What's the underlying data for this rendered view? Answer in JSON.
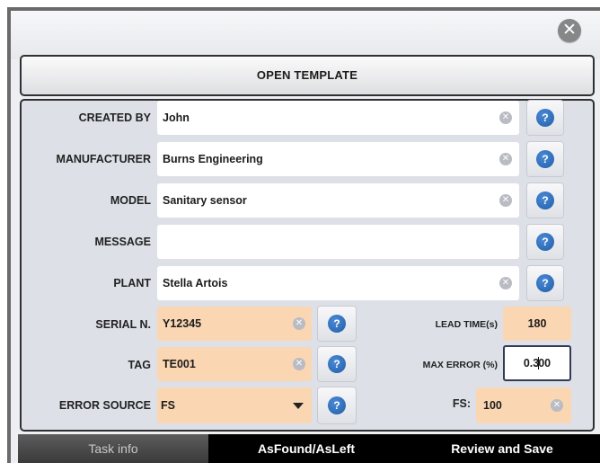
{
  "header": {
    "close_label": "✕",
    "open_template_label": "OPEN TEMPLATE"
  },
  "form": {
    "created_by": {
      "label": "CREATED BY",
      "value": "John"
    },
    "manufacturer": {
      "label": "MANUFACTURER",
      "value": "Burns Engineering"
    },
    "model": {
      "label": "MODEL",
      "value": "Sanitary sensor"
    },
    "message": {
      "label": "MESSAGE",
      "value": ""
    },
    "plant": {
      "label": "PLANT",
      "value": "Stella Artois"
    },
    "serial": {
      "label": "SERIAL N.",
      "value": "Y12345"
    },
    "tag": {
      "label": "TAG",
      "value": "TE001"
    },
    "error_source": {
      "label": "ERROR SOURCE",
      "value": "FS"
    },
    "lead_time": {
      "label": "LEAD TIME(s)",
      "value": "180"
    },
    "max_error": {
      "label": "MAX ERROR (%)",
      "value_before_caret": "0.3",
      "value_after_caret": "00"
    },
    "fs": {
      "label": "FS:",
      "value": "100"
    },
    "help_glyph": "?",
    "clear_glyph": "✕"
  },
  "tabs": [
    {
      "label": "Task info",
      "active": true
    },
    {
      "label": "AsFound/AsLeft",
      "active": false
    },
    {
      "label": "Review and Save",
      "active": false
    }
  ],
  "colors": {
    "orange_field": "#fbd6b3",
    "help_blue": "#1f5ea8",
    "tabbar": "#000000"
  }
}
